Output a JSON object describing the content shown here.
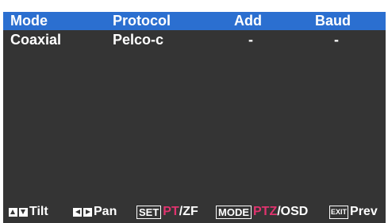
{
  "table": {
    "headers": [
      "Mode",
      "Protocol",
      "Add",
      "Baud"
    ],
    "rows": [
      [
        "Coaxial",
        "Pelco-c",
        "-",
        "-"
      ]
    ]
  },
  "footer": {
    "tilt_label": "Tilt",
    "pan_label": "Pan",
    "set_key": "SET",
    "set_accent": "PT",
    "set_rest": "/ZF",
    "mode_key": "MODE",
    "mode_accent": "PTZ",
    "mode_rest": "/OSD",
    "exit_key": "EXIT",
    "exit_rest": "Prev"
  },
  "colors": {
    "background": "#343434",
    "header": "#2b6fd0",
    "accent": "#e0336e",
    "text": "#ffffff"
  },
  "icons": [
    "up-arrow-icon",
    "down-arrow-icon",
    "left-arrow-icon",
    "right-arrow-icon"
  ]
}
